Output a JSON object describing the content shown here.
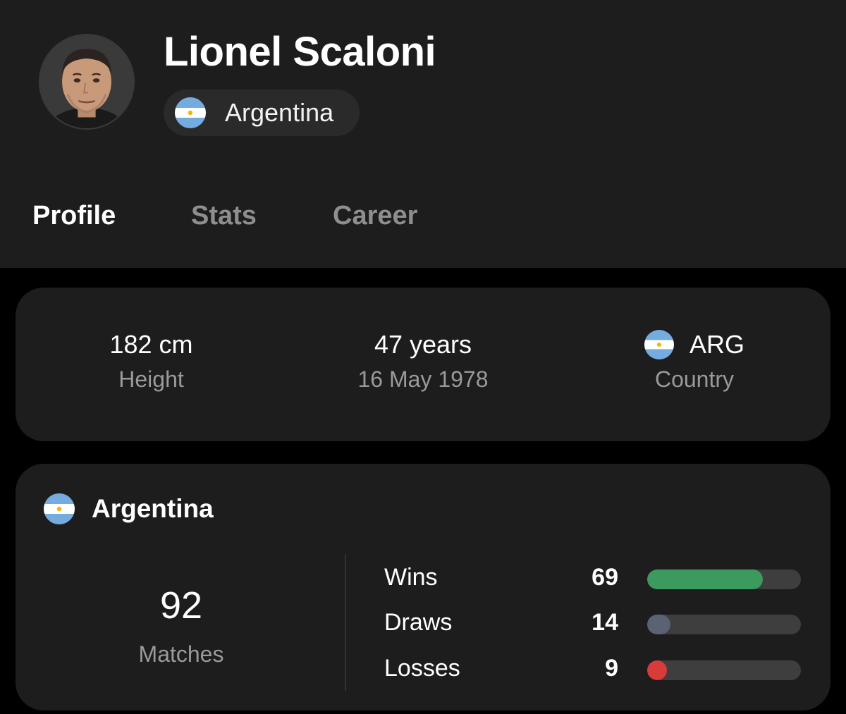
{
  "player": {
    "name": "Lionel Scaloni",
    "nationality": "Argentina",
    "flag_icon": "argentina-flag-icon"
  },
  "tabs": [
    {
      "label": "Profile",
      "active": true
    },
    {
      "label": "Stats",
      "active": false
    },
    {
      "label": "Career",
      "active": false
    }
  ],
  "info": {
    "height": {
      "value": "182 cm",
      "label": "Height"
    },
    "age": {
      "value": "47 years",
      "label": "16 May 1978"
    },
    "country": {
      "value": "ARG",
      "label": "Country"
    }
  },
  "team": {
    "name": "Argentina",
    "matches": {
      "value": "92",
      "label": "Matches"
    },
    "record": [
      {
        "label": "Wins",
        "value": "69",
        "fraction": 0.75,
        "color": "#3d9a5f"
      },
      {
        "label": "Draws",
        "value": "14",
        "fraction": 0.152,
        "color": "#5a6274"
      },
      {
        "label": "Losses",
        "value": "9",
        "fraction": 0.098,
        "color": "#d93a3a"
      }
    ]
  },
  "colors": {
    "background": "#000000",
    "card": "#1d1d1d",
    "muted_text": "#9a9a9a",
    "flag_blue": "#74acdf",
    "flag_sun": "#f6b40e"
  }
}
